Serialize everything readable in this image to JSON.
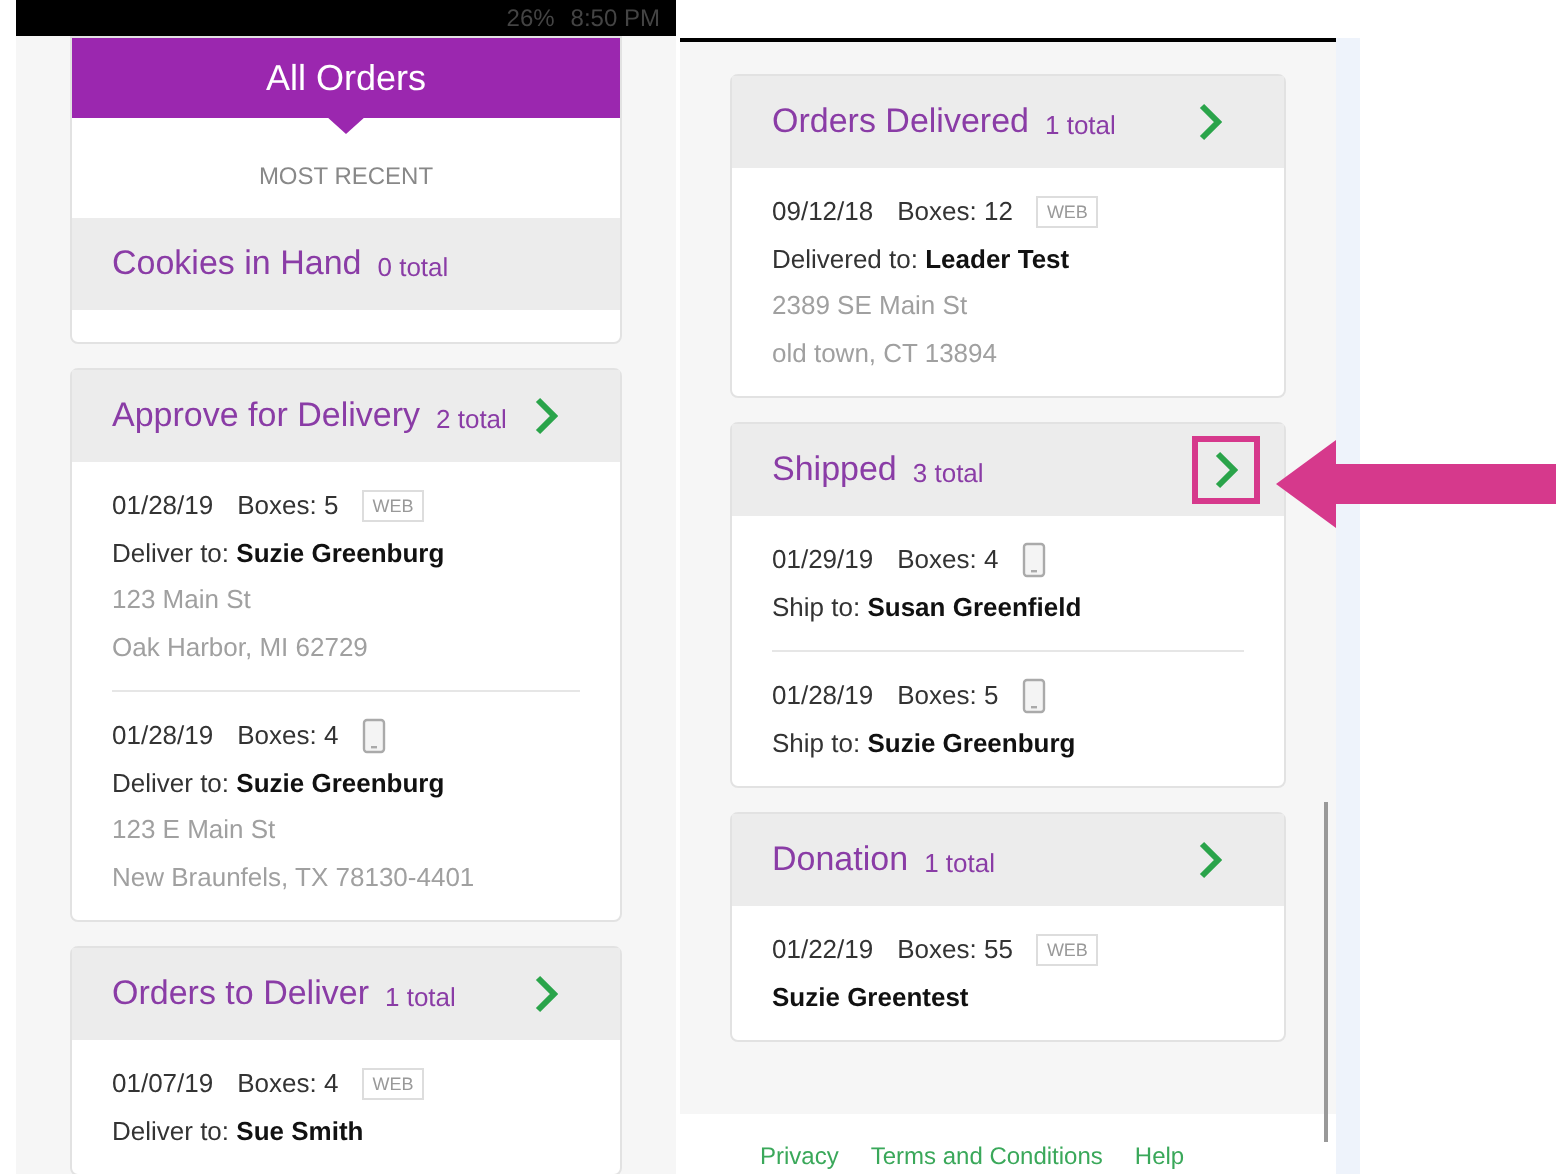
{
  "status_bar": {
    "battery": "26%",
    "time": "8:50 PM"
  },
  "left_screen": {
    "header": "All Orders",
    "subheader": "MOST RECENT",
    "sections": [
      {
        "title": "Cookies in Hand",
        "total": "0 total",
        "chevron": false
      },
      {
        "title": "Approve for Delivery",
        "total": "2 total",
        "chevron": true,
        "orders": [
          {
            "date": "01/28/19",
            "boxes": "Boxes: 5",
            "kind": "web",
            "source_label": "WEB",
            "recipient_label": "Deliver to:",
            "recipient": "Suzie Greenburg",
            "address": [
              "123 Main St",
              "Oak Harbor, MI 62729"
            ]
          },
          {
            "date": "01/28/19",
            "boxes": "Boxes: 4",
            "kind": "phone",
            "recipient_label": "Deliver to:",
            "recipient": "Suzie Greenburg",
            "address": [
              "123 E Main St",
              "New Braunfels, TX 78130-4401"
            ]
          }
        ]
      },
      {
        "title": "Orders to Deliver",
        "total": "1 total",
        "chevron": true,
        "orders": [
          {
            "date": "01/07/19",
            "boxes": "Boxes: 4",
            "kind": "web",
            "source_label": "WEB",
            "recipient_label": "Deliver to:",
            "recipient": "Sue Smith"
          }
        ]
      }
    ]
  },
  "right_screen": {
    "sections": [
      {
        "title": "Orders Delivered",
        "total": "1 total",
        "chevron": true,
        "orders": [
          {
            "date": "09/12/18",
            "boxes": "Boxes: 12",
            "kind": "web",
            "source_label": "WEB",
            "recipient_label": "Delivered to:",
            "recipient": "Leader Test",
            "address": [
              "2389 SE Main St",
              "old town, CT 13894"
            ]
          }
        ]
      },
      {
        "title": "Shipped",
        "total": "3 total",
        "chevron": true,
        "highlighted": true,
        "orders": [
          {
            "date": "01/29/19",
            "boxes": "Boxes: 4",
            "kind": "phone",
            "recipient_label": "Ship to:",
            "recipient": "Susan Greenfield"
          },
          {
            "date": "01/28/19",
            "boxes": "Boxes: 5",
            "kind": "phone",
            "recipient_label": "Ship to:",
            "recipient": "Suzie Greenburg"
          }
        ]
      },
      {
        "title": "Donation",
        "total": "1 total",
        "chevron": true,
        "orders": [
          {
            "date": "01/22/19",
            "boxes": "Boxes: 55",
            "kind": "web",
            "source_label": "WEB",
            "recipient": "Suzie Greentest"
          }
        ]
      }
    ],
    "footer_links": [
      "Privacy",
      "Terms and Conditions",
      "Help"
    ]
  }
}
